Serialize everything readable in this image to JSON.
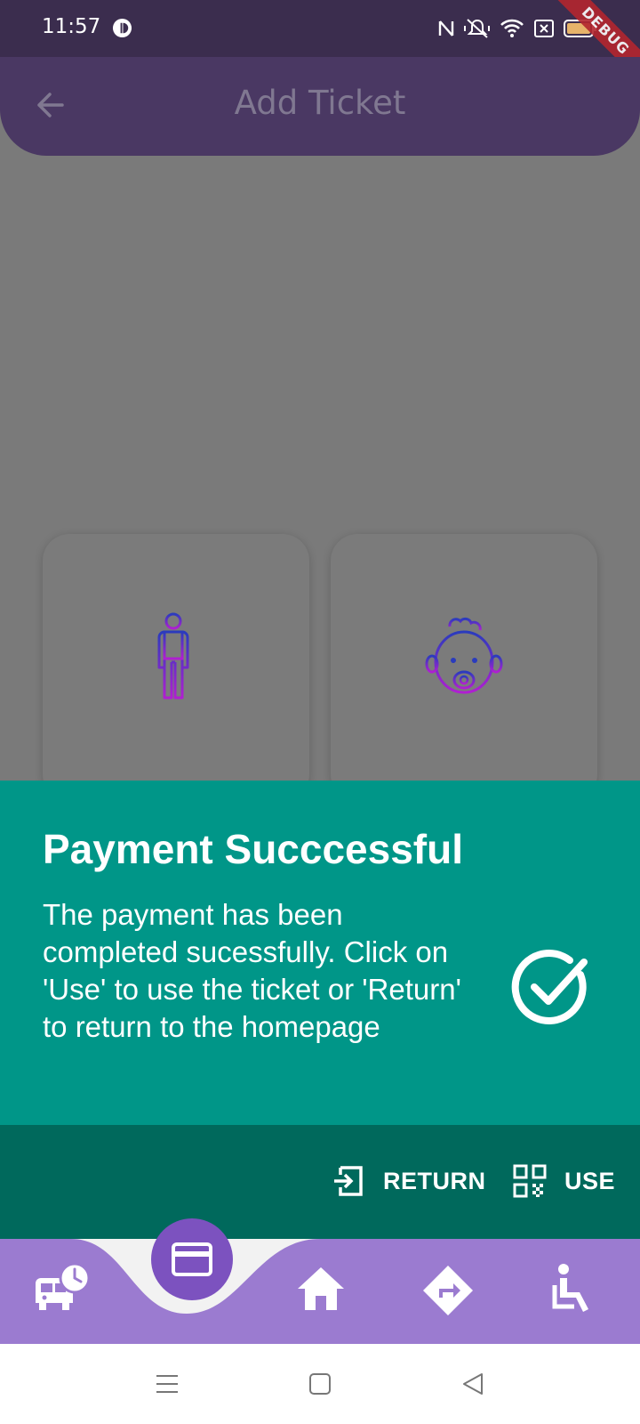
{
  "status_bar": {
    "time": "11:57",
    "icons": [
      "notification-icon",
      "nfc-icon",
      "mute-icon",
      "wifi-icon",
      "sim-icon",
      "battery-icon"
    ],
    "battery_level": "94"
  },
  "debug_banner": "DEBUG",
  "app_bar": {
    "title": "Add Ticket",
    "back_icon": "arrow-left-icon"
  },
  "ticket_types": [
    {
      "icon": "adult-person-icon"
    },
    {
      "icon": "baby-face-icon"
    }
  ],
  "snackbar": {
    "title": "Payment Succcessful",
    "message": "The payment has been completed sucessfully. Click on 'Use' to use the ticket or 'Return' to return to the homepage",
    "icon": "check-circle-icon",
    "actions": {
      "return_label": "RETURN",
      "use_label": "USE"
    }
  },
  "bottom_nav": {
    "items": [
      "bus-schedule-icon",
      "card-icon",
      "home-icon",
      "directions-icon",
      "accessible-seat-icon"
    ],
    "active": "card-icon"
  },
  "colors": {
    "status_bar": "#3b2d4e",
    "app_bar": "#4a3863",
    "overlay": "#7a7a7a",
    "snackbar": "#009688",
    "snackbar_actions": "#00695c",
    "bottom_nav": "#9b7bd0",
    "active_nav": "#7c52bf"
  }
}
